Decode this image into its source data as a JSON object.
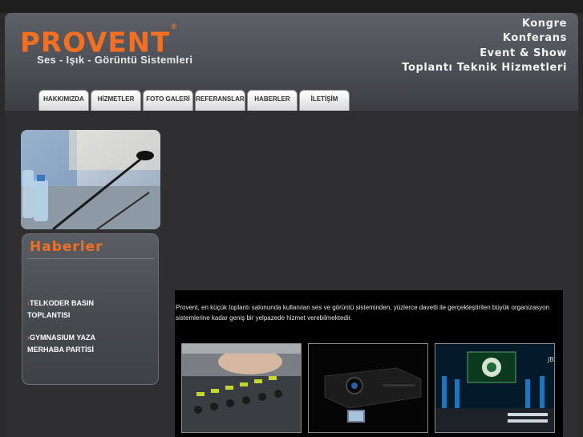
{
  "brand": {
    "logo": "PROVENT",
    "trademark": "®",
    "tagline": "Ses - Işık - Görüntü Sistemleri"
  },
  "slogan": [
    "Kongre",
    "Konferans",
    "Event & Show",
    "Toplantı Teknik Hizmetleri"
  ],
  "nav": [
    "HAKKIMIZDA",
    "HİZMETLER",
    "FOTO GALERİ",
    "REFERANSLAR",
    "HABERLER",
    "İLETİŞİM"
  ],
  "news": {
    "title": "Haberler",
    "items": [
      {
        "arrow": "›",
        "label": "TELKODER BASIN TOPLANTISI"
      },
      {
        "arrow": "›",
        "label": "GYMNASIUM YAZA MERHABA PARTİSİ"
      }
    ]
  },
  "intro": "Provent, en küçük toplantı salonunda kullanılan ses ve görüntü sisteminden, yüzlerce davetli ile gerçekleştirilen büyük organizasyon sistemlerine kadar geniş bir yelpazede hizmet verebilmektedir.",
  "colors": {
    "accent": "#f36f21",
    "background": "#2b2b2c",
    "content_bg": "#000000"
  },
  "images": [
    "conference-microphones-photo",
    "mixing-console-photo",
    "projector-photo",
    "stage-led-screen-photo"
  ]
}
